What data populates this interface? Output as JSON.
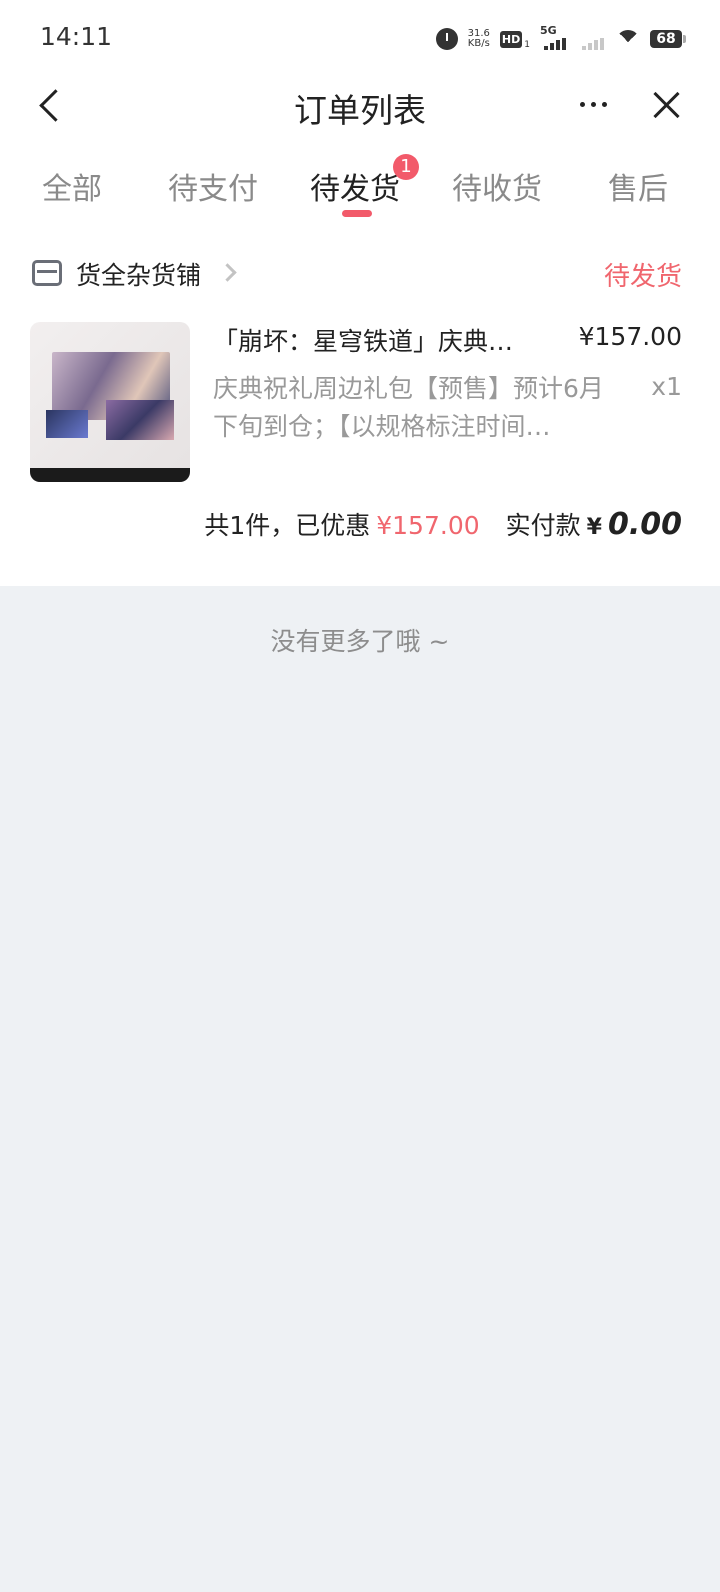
{
  "status_bar": {
    "time": "14:11",
    "net_speed_value": "31.6",
    "net_speed_unit": "KB/s",
    "hd_label": "HD",
    "hd_sub": "1",
    "network": "5G",
    "battery": "68"
  },
  "nav": {
    "title": "订单列表"
  },
  "tabs": [
    {
      "label": "全部"
    },
    {
      "label": "待支付"
    },
    {
      "label": "待发货",
      "badge": "1",
      "active": true
    },
    {
      "label": "待收货"
    },
    {
      "label": "售后"
    }
  ],
  "order": {
    "shop_name": "货全杂货铺",
    "status": "待发货",
    "product_title": "「崩坏：星穹铁道」庆典…",
    "price": "¥157.00",
    "description": "庆典祝礼周边礼包【预售】预计6月下旬到仓；【以规格标注时间…",
    "quantity": "x1",
    "summary_count": "共1件，已优惠",
    "summary_discount": "¥157.00",
    "summary_paid_label": "实付款",
    "summary_currency": "¥",
    "summary_paid_amount": "0.00"
  },
  "footer": {
    "no_more": "没有更多了哦 ~"
  },
  "colors": {
    "accent": "#f25a6a",
    "status_red": "#f0666e",
    "background": "#eef1f4"
  }
}
